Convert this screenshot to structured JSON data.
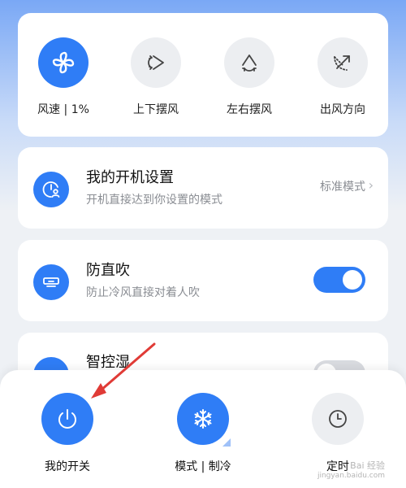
{
  "wind": {
    "items": [
      {
        "label": "风速 | 1%",
        "icon": "fan-icon",
        "active": true
      },
      {
        "label": "上下摆风",
        "icon": "vertical-swing-icon",
        "active": false
      },
      {
        "label": "左右摆风",
        "icon": "horizontal-swing-icon",
        "active": false
      },
      {
        "label": "出风方向",
        "icon": "airflow-direction-icon",
        "active": false
      }
    ]
  },
  "settings": {
    "startup": {
      "title": "我的开机设置",
      "subtitle": "开机直接达到你设置的模式",
      "value": "标准模式",
      "chevron": "›"
    },
    "anti_direct": {
      "title": "防直吹",
      "subtitle": "防止冷风直接对着人吹",
      "enabled": true
    },
    "smart_humidity": {
      "title": "智控湿"
    }
  },
  "bottom": {
    "power": {
      "label": "我的开关",
      "icon": "power-icon"
    },
    "mode": {
      "label": "模式 | 制冷",
      "icon": "snowflake-icon"
    },
    "timer": {
      "label": "定时",
      "icon": "clock-icon"
    }
  },
  "watermark": {
    "line1": "Bai 经验",
    "line2": "jingyan.baidu.com"
  },
  "colors": {
    "accent": "#2f7df6",
    "annotation_arrow": "#e03b36"
  }
}
